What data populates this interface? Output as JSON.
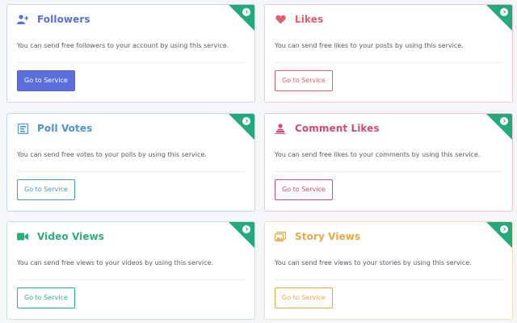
{
  "cards": [
    {
      "title": "Followers",
      "description": "You can send free followers to your account by using this service.",
      "button": "Go to Service",
      "accent": "#5b6fdc",
      "border": "#c9cfec",
      "icon": "add-user-icon",
      "button_style": "filled"
    },
    {
      "title": "Likes",
      "description": "You can send free likes to your posts by using this service.",
      "button": "Go to Service",
      "accent": "#e0606d",
      "border": "#f2c8cd",
      "icon": "heart-icon",
      "button_style": "outline"
    },
    {
      "title": "Poll Votes",
      "description": "You can send free votes to your polls by using this service.",
      "button": "Go to Service",
      "accent": "#4a97c9",
      "border": "#c3dced",
      "icon": "poll-icon",
      "button_style": "outline"
    },
    {
      "title": "Comment Likes",
      "description": "You can send free likes to your comments by using this service.",
      "button": "Go to Service",
      "accent": "#cf4d6f",
      "border": "#efc6d2",
      "icon": "comment-like-icon",
      "button_style": "outline"
    },
    {
      "title": "Video Views",
      "description": "You can send free views to your videos by using this service.",
      "button": "Go to Service",
      "accent": "#2bb07a",
      "border": "#c0e8d8",
      "icon": "video-icon",
      "button_style": "outline"
    },
    {
      "title": "Story Views",
      "description": "You can send free views to your stories by using this service.",
      "button": "Go to Service",
      "accent": "#e7a94a",
      "border": "#f3e0bd",
      "icon": "story-icon",
      "button_style": "outline"
    }
  ],
  "corner_color": "#26a87d"
}
